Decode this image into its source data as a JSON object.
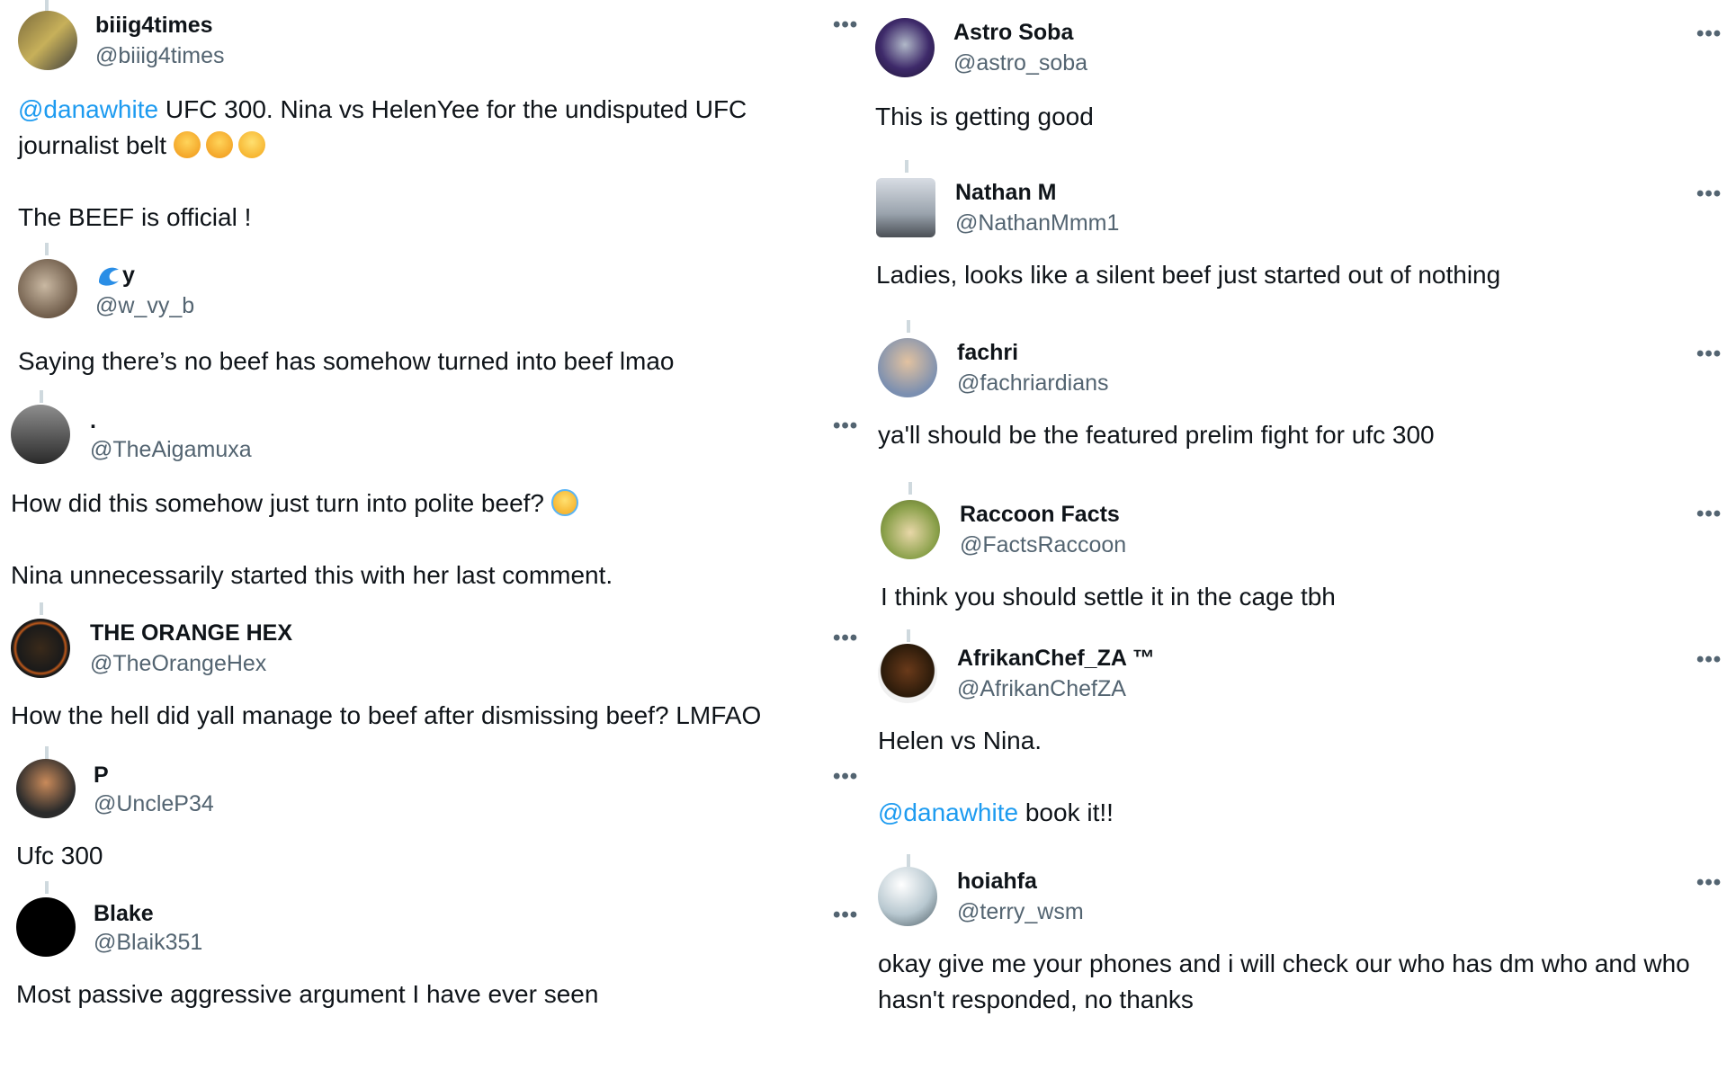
{
  "left_replies": [
    {
      "name": "biiig4times",
      "handle": "@biiig4times",
      "mention": "@danawhite",
      "line1": " UFC 300. Nina vs HelenYee for the undisputed UFC",
      "line2": "journalist belt",
      "line3": "The BEEF is official !"
    },
    {
      "name": "y",
      "handle": "@w_vy_b",
      "line1": "Saying there’s no beef has somehow turned into beef lmao"
    },
    {
      "name": ".",
      "handle": "@TheAigamuxa",
      "line1": "How did this somehow just turn into polite beef?",
      "line2": "Nina unnecessarily started this with her last comment."
    },
    {
      "name": "THE ORANGE HEX",
      "handle": "@TheOrangeHex",
      "line1": "How the hell did yall manage to beef after dismissing beef? LMFAO"
    },
    {
      "name": "P",
      "handle": "@UncleP34",
      "line1": "Ufc 300"
    },
    {
      "name": "Blake",
      "handle": "@Blaik351",
      "line1": "Most passive aggressive argument I have ever seen"
    }
  ],
  "right_replies": [
    {
      "name": "Astro Soba",
      "handle": "@astro_soba",
      "line1": "This is getting good"
    },
    {
      "name": "Nathan M",
      "handle": "@NathanMmm1",
      "line1": "Ladies, looks like a silent beef just started out of nothing"
    },
    {
      "name": "fachri",
      "handle": "@fachriardians",
      "line1": "ya'll should be the featured prelim fight for ufc 300"
    },
    {
      "name": "Raccoon Facts",
      "handle": "@FactsRaccoon",
      "line1": "I think you should settle it in the cage tbh"
    },
    {
      "name": "AfrikanChef_ZA ™",
      "handle": "@AfrikanChefZA",
      "line1": "Helen vs Nina.",
      "mention": "@danawhite",
      "line2": " book it!!"
    },
    {
      "name": "hoiahfa",
      "handle": "@terry_wsm",
      "line1": "okay give me your phones and i will check our who has dm who and who",
      "line2": "hasn't responded, no thanks"
    }
  ],
  "ui": {
    "more_label": "•••"
  },
  "colors": {
    "mention": "#1d9bf0",
    "handle": "#536471",
    "text": "#0f1419",
    "thread_line": "#cfd9de"
  }
}
